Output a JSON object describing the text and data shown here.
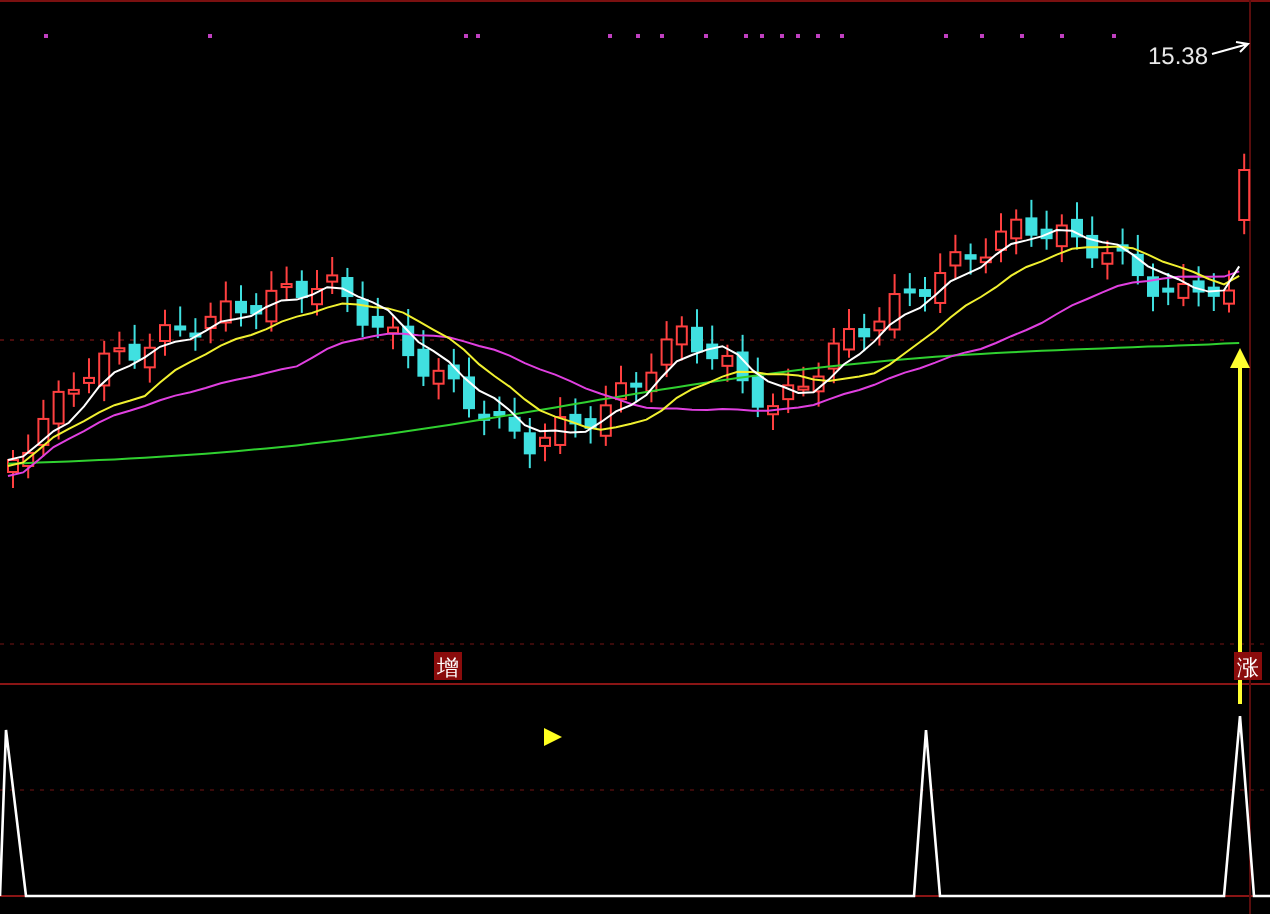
{
  "price_panel": {
    "high_label": "15.38"
  },
  "signals": [
    {
      "text": "增"
    },
    {
      "text": "涨"
    }
  ]
}
